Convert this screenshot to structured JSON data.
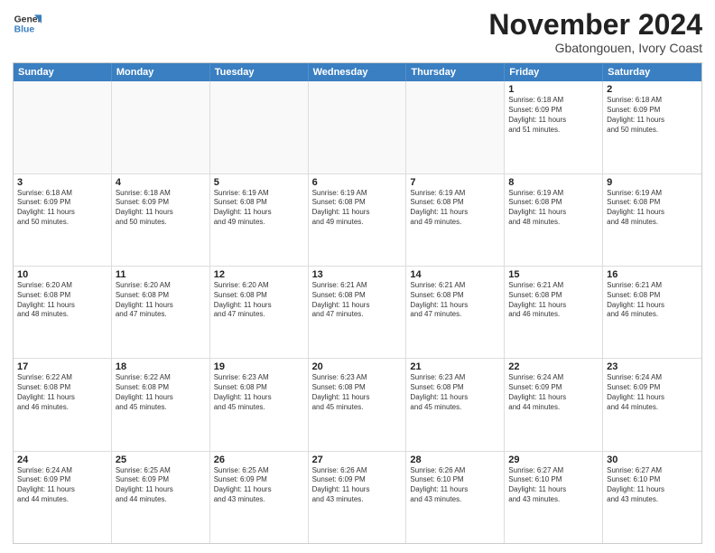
{
  "header": {
    "logo_line1": "General",
    "logo_line2": "Blue",
    "month_title": "November 2024",
    "subtitle": "Gbatongouen, Ivory Coast"
  },
  "weekdays": [
    "Sunday",
    "Monday",
    "Tuesday",
    "Wednesday",
    "Thursday",
    "Friday",
    "Saturday"
  ],
  "rows": [
    [
      {
        "day": "",
        "info": ""
      },
      {
        "day": "",
        "info": ""
      },
      {
        "day": "",
        "info": ""
      },
      {
        "day": "",
        "info": ""
      },
      {
        "day": "",
        "info": ""
      },
      {
        "day": "1",
        "info": "Sunrise: 6:18 AM\nSunset: 6:09 PM\nDaylight: 11 hours\nand 51 minutes."
      },
      {
        "day": "2",
        "info": "Sunrise: 6:18 AM\nSunset: 6:09 PM\nDaylight: 11 hours\nand 50 minutes."
      }
    ],
    [
      {
        "day": "3",
        "info": "Sunrise: 6:18 AM\nSunset: 6:09 PM\nDaylight: 11 hours\nand 50 minutes."
      },
      {
        "day": "4",
        "info": "Sunrise: 6:18 AM\nSunset: 6:09 PM\nDaylight: 11 hours\nand 50 minutes."
      },
      {
        "day": "5",
        "info": "Sunrise: 6:19 AM\nSunset: 6:08 PM\nDaylight: 11 hours\nand 49 minutes."
      },
      {
        "day": "6",
        "info": "Sunrise: 6:19 AM\nSunset: 6:08 PM\nDaylight: 11 hours\nand 49 minutes."
      },
      {
        "day": "7",
        "info": "Sunrise: 6:19 AM\nSunset: 6:08 PM\nDaylight: 11 hours\nand 49 minutes."
      },
      {
        "day": "8",
        "info": "Sunrise: 6:19 AM\nSunset: 6:08 PM\nDaylight: 11 hours\nand 48 minutes."
      },
      {
        "day": "9",
        "info": "Sunrise: 6:19 AM\nSunset: 6:08 PM\nDaylight: 11 hours\nand 48 minutes."
      }
    ],
    [
      {
        "day": "10",
        "info": "Sunrise: 6:20 AM\nSunset: 6:08 PM\nDaylight: 11 hours\nand 48 minutes."
      },
      {
        "day": "11",
        "info": "Sunrise: 6:20 AM\nSunset: 6:08 PM\nDaylight: 11 hours\nand 47 minutes."
      },
      {
        "day": "12",
        "info": "Sunrise: 6:20 AM\nSunset: 6:08 PM\nDaylight: 11 hours\nand 47 minutes."
      },
      {
        "day": "13",
        "info": "Sunrise: 6:21 AM\nSunset: 6:08 PM\nDaylight: 11 hours\nand 47 minutes."
      },
      {
        "day": "14",
        "info": "Sunrise: 6:21 AM\nSunset: 6:08 PM\nDaylight: 11 hours\nand 47 minutes."
      },
      {
        "day": "15",
        "info": "Sunrise: 6:21 AM\nSunset: 6:08 PM\nDaylight: 11 hours\nand 46 minutes."
      },
      {
        "day": "16",
        "info": "Sunrise: 6:21 AM\nSunset: 6:08 PM\nDaylight: 11 hours\nand 46 minutes."
      }
    ],
    [
      {
        "day": "17",
        "info": "Sunrise: 6:22 AM\nSunset: 6:08 PM\nDaylight: 11 hours\nand 46 minutes."
      },
      {
        "day": "18",
        "info": "Sunrise: 6:22 AM\nSunset: 6:08 PM\nDaylight: 11 hours\nand 45 minutes."
      },
      {
        "day": "19",
        "info": "Sunrise: 6:23 AM\nSunset: 6:08 PM\nDaylight: 11 hours\nand 45 minutes."
      },
      {
        "day": "20",
        "info": "Sunrise: 6:23 AM\nSunset: 6:08 PM\nDaylight: 11 hours\nand 45 minutes."
      },
      {
        "day": "21",
        "info": "Sunrise: 6:23 AM\nSunset: 6:08 PM\nDaylight: 11 hours\nand 45 minutes."
      },
      {
        "day": "22",
        "info": "Sunrise: 6:24 AM\nSunset: 6:09 PM\nDaylight: 11 hours\nand 44 minutes."
      },
      {
        "day": "23",
        "info": "Sunrise: 6:24 AM\nSunset: 6:09 PM\nDaylight: 11 hours\nand 44 minutes."
      }
    ],
    [
      {
        "day": "24",
        "info": "Sunrise: 6:24 AM\nSunset: 6:09 PM\nDaylight: 11 hours\nand 44 minutes."
      },
      {
        "day": "25",
        "info": "Sunrise: 6:25 AM\nSunset: 6:09 PM\nDaylight: 11 hours\nand 44 minutes."
      },
      {
        "day": "26",
        "info": "Sunrise: 6:25 AM\nSunset: 6:09 PM\nDaylight: 11 hours\nand 43 minutes."
      },
      {
        "day": "27",
        "info": "Sunrise: 6:26 AM\nSunset: 6:09 PM\nDaylight: 11 hours\nand 43 minutes."
      },
      {
        "day": "28",
        "info": "Sunrise: 6:26 AM\nSunset: 6:10 PM\nDaylight: 11 hours\nand 43 minutes."
      },
      {
        "day": "29",
        "info": "Sunrise: 6:27 AM\nSunset: 6:10 PM\nDaylight: 11 hours\nand 43 minutes."
      },
      {
        "day": "30",
        "info": "Sunrise: 6:27 AM\nSunset: 6:10 PM\nDaylight: 11 hours\nand 43 minutes."
      }
    ]
  ]
}
